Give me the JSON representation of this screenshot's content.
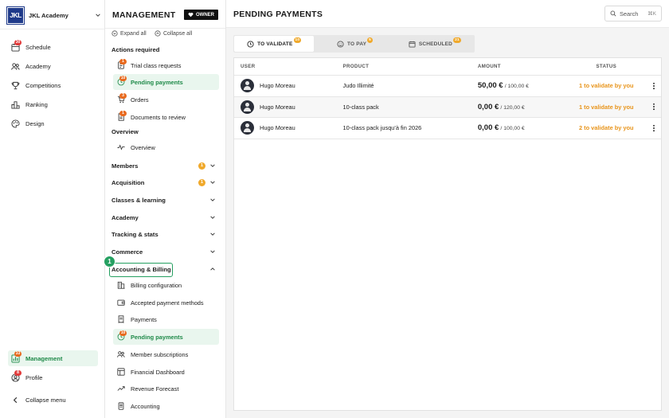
{
  "club": {
    "logo_text": "JKL",
    "name": "JKL Academy"
  },
  "rail": {
    "items": [
      {
        "label": "Schedule",
        "icon": "calendar-icon",
        "badge": "30"
      },
      {
        "label": "Academy",
        "icon": "people-icon"
      },
      {
        "label": "Competitions",
        "icon": "trophy-icon"
      },
      {
        "label": "Ranking",
        "icon": "podium-icon"
      },
      {
        "label": "Design",
        "icon": "palette-icon"
      }
    ],
    "bottom": [
      {
        "label": "Management",
        "icon": "management-icon",
        "badge": "33",
        "active": true
      },
      {
        "label": "Profile",
        "icon": "user-icon",
        "badge": "8"
      },
      {
        "label": "Collapse menu",
        "icon": "chevron-left-icon"
      }
    ]
  },
  "panel": {
    "title": "MANAGEMENT",
    "owner_label": "OWNER",
    "expand_all": "Expand all",
    "collapse_all": "Collapse all",
    "actions_required": {
      "label": "Actions required",
      "items": [
        {
          "label": "Trial class requests",
          "icon": "trial-icon",
          "badge": "1"
        },
        {
          "label": "Pending payments",
          "icon": "pending-payment-icon",
          "badge": "10",
          "active": true
        },
        {
          "label": "Orders",
          "icon": "cart-icon",
          "badge": "3"
        },
        {
          "label": "Documents to review",
          "icon": "document-icon",
          "badge": "1"
        }
      ]
    },
    "overview": {
      "label": "Overview",
      "item": "Overview"
    },
    "groups": [
      {
        "label": "Members",
        "badge": "1"
      },
      {
        "label": "Acquisition",
        "badge": "1"
      },
      {
        "label": "Classes & learning"
      },
      {
        "label": "Academy"
      },
      {
        "label": "Tracking & stats"
      },
      {
        "label": "Commerce"
      },
      {
        "label": "Accounting & Billing",
        "expanded": true,
        "step": "1"
      }
    ],
    "accounting_items": [
      {
        "label": "Billing configuration",
        "icon": "building-icon"
      },
      {
        "label": "Accepted payment methods",
        "icon": "wallet-icon"
      },
      {
        "label": "Payments",
        "icon": "receipt-icon"
      },
      {
        "label": "Pending payments",
        "icon": "pending-payment-icon",
        "badge": "10",
        "active": true
      },
      {
        "label": "Member subscriptions",
        "icon": "members-icon"
      },
      {
        "label": "Financial Dashboard",
        "icon": "dashboard-icon"
      },
      {
        "label": "Revenue Forecast",
        "icon": "trend-icon"
      },
      {
        "label": "Accounting",
        "icon": "ledger-icon"
      }
    ]
  },
  "main": {
    "title": "PENDING PAYMENTS",
    "search_label": "Search",
    "search_shortcut": "⌘K",
    "tabs": [
      {
        "label": "TO VALIDATE",
        "badge": "10",
        "icon": "clock-icon",
        "active": true
      },
      {
        "label": "TO PAY",
        "badge": "5",
        "icon": "smile-icon"
      },
      {
        "label": "SCHEDULED",
        "badge": "21",
        "icon": "calendar-icon"
      }
    ],
    "columns": [
      "USER",
      "PRODUCT",
      "AMOUNT",
      "STATUS"
    ],
    "rows": [
      {
        "user": "Hugo Moreau",
        "product": "Judo Illimité",
        "amount": "50,00 €",
        "total": "/ 100,00 €",
        "status": "1 to validate by you"
      },
      {
        "user": "Hugo Moreau",
        "product": "10-class pack",
        "amount": "0,00 €",
        "total": "/ 120,00 €",
        "status": "1 to validate by you"
      },
      {
        "user": "Hugo Moreau",
        "product": "10-class pack jusqu'à fin 2026",
        "amount": "0,00 €",
        "total": "/ 100,00 €",
        "status": "2 to validate by you"
      }
    ]
  },
  "colors": {
    "accent_green": "#25a061",
    "status_orange": "#e8941a",
    "badge_orange": "#e86a1f",
    "brand_blue": "#1f3a8a"
  }
}
